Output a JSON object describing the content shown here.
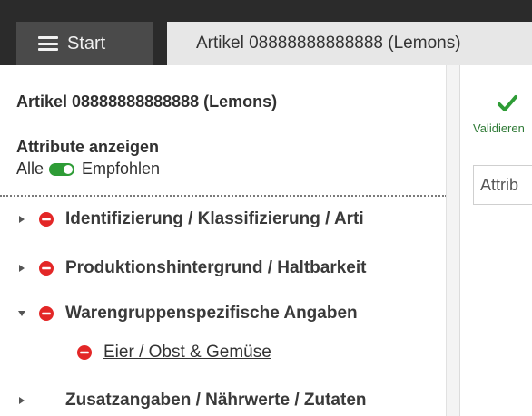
{
  "tabs": {
    "start_label": "Start",
    "article_label": "Artikel 08888888888888 (Lemons)"
  },
  "left_panel": {
    "title": "Artikel 08888888888888 (Lemons)",
    "attributes_heading": "Attribute anzeigen",
    "toggle_left_label": "Alle",
    "toggle_right_label": "Empfohlen",
    "items": [
      {
        "label": "Identifizierung / Klassifizierung / Arti",
        "status": "error",
        "expanded": false
      },
      {
        "label": "Produktionshintergrund / Haltbarkeit",
        "status": "error",
        "expanded": false
      },
      {
        "label": "Warengruppenspezifische Angaben",
        "status": "error",
        "expanded": true
      },
      {
        "label": "Zusatzangaben / Nährwerte / Zutaten",
        "status": "none",
        "expanded": false
      }
    ],
    "subitem": {
      "label": "Eier / Obst & Gemüse",
      "status": "error"
    }
  },
  "right_panel": {
    "validate_label": "Validieren",
    "attribute_input_value": "Attrib"
  },
  "icons": {
    "menu": "menu-icon",
    "error": "error-icon",
    "check": "check-icon",
    "caret_right": "caret-right-icon",
    "caret_down": "caret-down-icon"
  },
  "colors": {
    "tab_bar": "#2b2b2b",
    "start_tab": "#4a4a4a",
    "active_tab": "#e7e7e7",
    "error": "#e32727",
    "success": "#2e9c36",
    "text": "#303030"
  }
}
